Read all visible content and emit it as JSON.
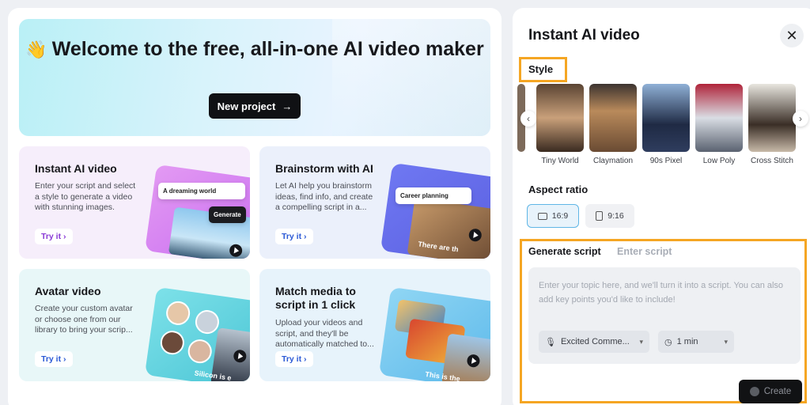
{
  "hero": {
    "emoji": "👋",
    "title": "Welcome to the free, all-in-one AI video maker",
    "new_project_label": "New project"
  },
  "cards": [
    {
      "title": "Instant AI video",
      "description": "Enter your script and select a style to generate a video with stunning images.",
      "try_label": "Try it",
      "chip_text": "A dreaming world",
      "chip_button": "Generate"
    },
    {
      "title": "Brainstorm with AI",
      "description": "Let AI help you brainstorm ideas, find info, and create a compelling script in a...",
      "try_label": "Try it",
      "chip_text": "Career planning",
      "overlay_text": "There are th"
    },
    {
      "title": "Avatar video",
      "description": "Create your custom avatar or choose one from our library to bring your scrip...",
      "try_label": "Try it",
      "overlay_text": "Silicon is e"
    },
    {
      "title": "Match media to script in 1 click",
      "description": "Upload your videos and script, and they'll be automatically matched to...",
      "try_label": "Try it",
      "overlay_text": "This is the"
    }
  ],
  "panel": {
    "title": "Instant AI video",
    "style_label": "Style",
    "styles": [
      "Tiny World",
      "Claymation",
      "90s Pixel",
      "Low Poly",
      "Cross Stitch"
    ],
    "aspect_label": "Aspect ratio",
    "aspect_options": [
      "16:9",
      "9:16"
    ],
    "selected_aspect": "16:9",
    "tab_generate": "Generate script",
    "tab_enter": "Enter script",
    "placeholder": "Enter your topic here, and we'll turn it into a script. You can also add key points you'd like to include!",
    "voice": "Excited Comme...",
    "duration": "1 min",
    "create_label": "Create"
  },
  "colors": {
    "highlight": "#f5a623",
    "primary_dark": "#101114",
    "try_purple": "#8a3bd6",
    "try_blue": "#2c5ad6"
  }
}
